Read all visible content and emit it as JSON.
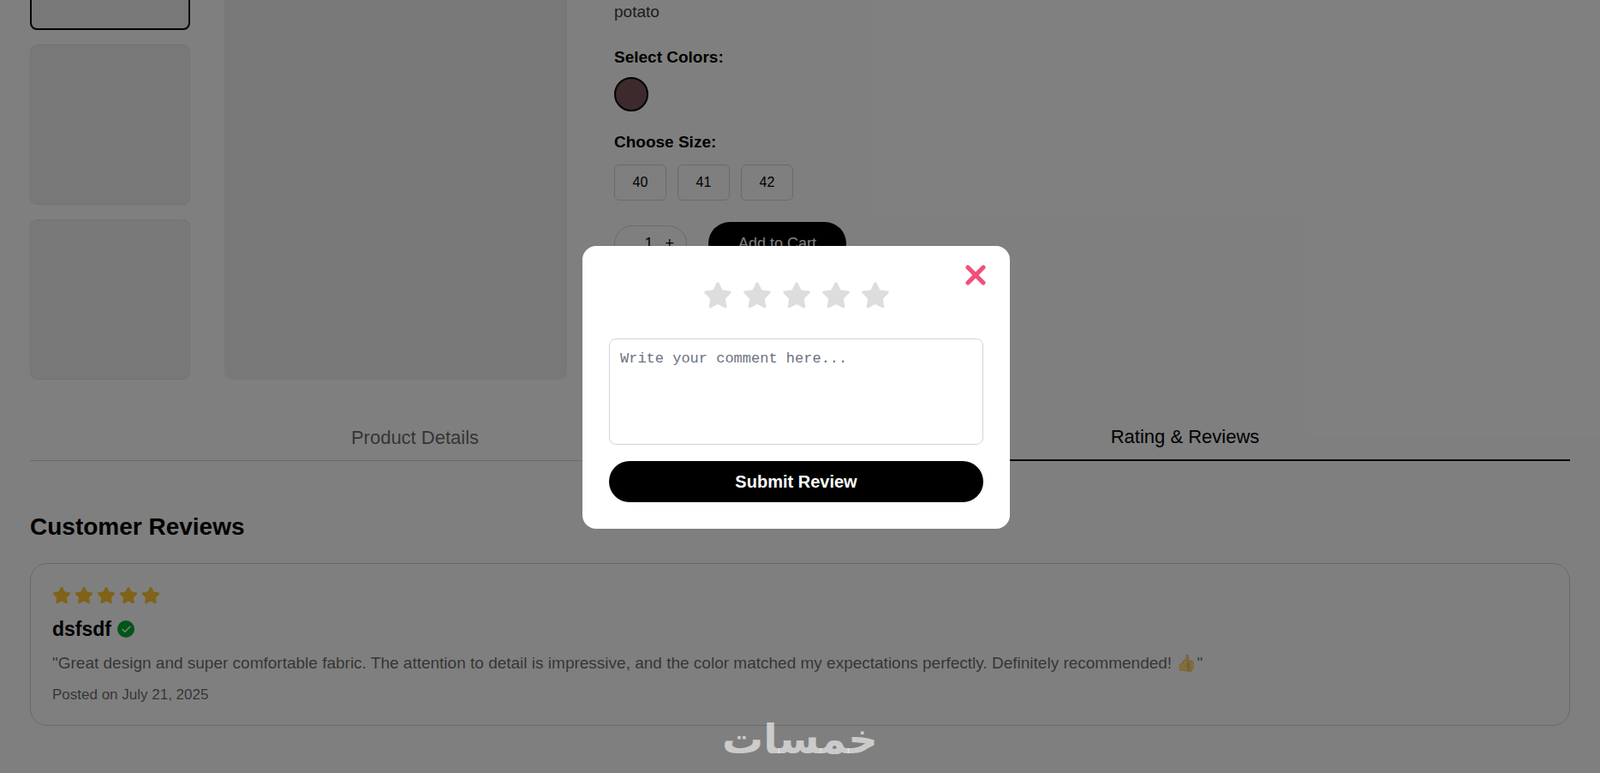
{
  "product": {
    "name": "potato",
    "thumbnails": [
      {
        "selected": true
      },
      {
        "selected": false
      },
      {
        "selected": false
      }
    ],
    "colors_label": "Select Colors:",
    "colors": [
      {
        "color": "#7a5458",
        "selected": true
      }
    ],
    "size_label": "Choose Size:",
    "sizes": [
      {
        "label": "40",
        "selected": false
      },
      {
        "label": "41",
        "selected": false
      },
      {
        "label": "42",
        "selected": false
      }
    ],
    "quantity": "1",
    "plus": "+",
    "add_to_cart": "Add to Cart"
  },
  "tabs": [
    {
      "label": "Product Details",
      "selected": false
    },
    {
      "label": "Rating & Reviews",
      "selected": true
    }
  ],
  "reviews": {
    "heading": "Customer Reviews",
    "items": [
      {
        "stars": 5,
        "name": "dsfsdf",
        "verified": true,
        "text": "\"Great design and super comfortable fabric. The attention to detail is impressive, and the color matched my expectations perfectly. Definitely recommended! 👍\"",
        "date": "Posted on July 21, 2025"
      }
    ]
  },
  "modal": {
    "open": true,
    "stars": 0,
    "placeholder": "Write your comment here...",
    "submit": "Submit Review"
  },
  "watermark": "خمسات"
}
